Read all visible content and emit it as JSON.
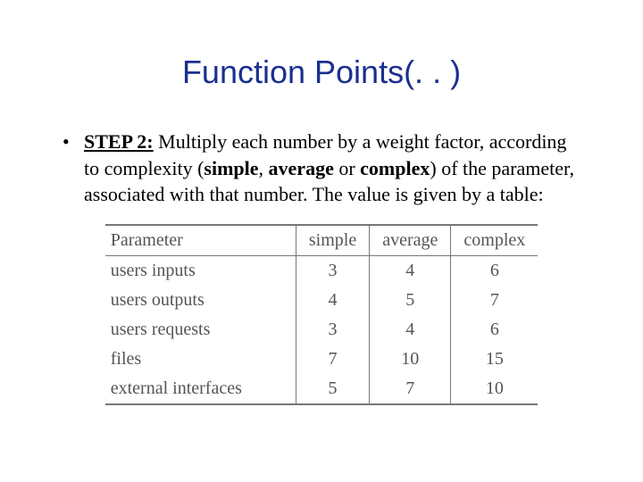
{
  "title": "Function Points(. . )",
  "bullet": {
    "step_label": "STEP 2:",
    "text_part1": " Multiply each number by a weight factor, according to complexity (",
    "kw1": "simple",
    "sep1": ", ",
    "kw2": "average",
    "sep2": " or ",
    "kw3": "complex",
    "text_part2": ") of the parameter, associated with that number. The value is given by a table:"
  },
  "table": {
    "headers": [
      "Parameter",
      "simple",
      "average",
      "complex"
    ],
    "rows": [
      {
        "label": "users inputs",
        "cells": [
          "3",
          "4",
          "6"
        ]
      },
      {
        "label": "users outputs",
        "cells": [
          "4",
          "5",
          "7"
        ]
      },
      {
        "label": "users requests",
        "cells": [
          "3",
          "4",
          "6"
        ]
      },
      {
        "label": "files",
        "cells": [
          "7",
          "10",
          "15"
        ]
      },
      {
        "label": "external interfaces",
        "cells": [
          "5",
          "7",
          "10"
        ]
      }
    ]
  },
  "chart_data": {
    "type": "table",
    "title": "Function Point weight factors by complexity",
    "columns": [
      "Parameter",
      "simple",
      "average",
      "complex"
    ],
    "rows": [
      [
        "users inputs",
        3,
        4,
        6
      ],
      [
        "users outputs",
        4,
        5,
        7
      ],
      [
        "users requests",
        3,
        4,
        6
      ],
      [
        "files",
        7,
        10,
        15
      ],
      [
        "external interfaces",
        5,
        7,
        10
      ]
    ]
  }
}
